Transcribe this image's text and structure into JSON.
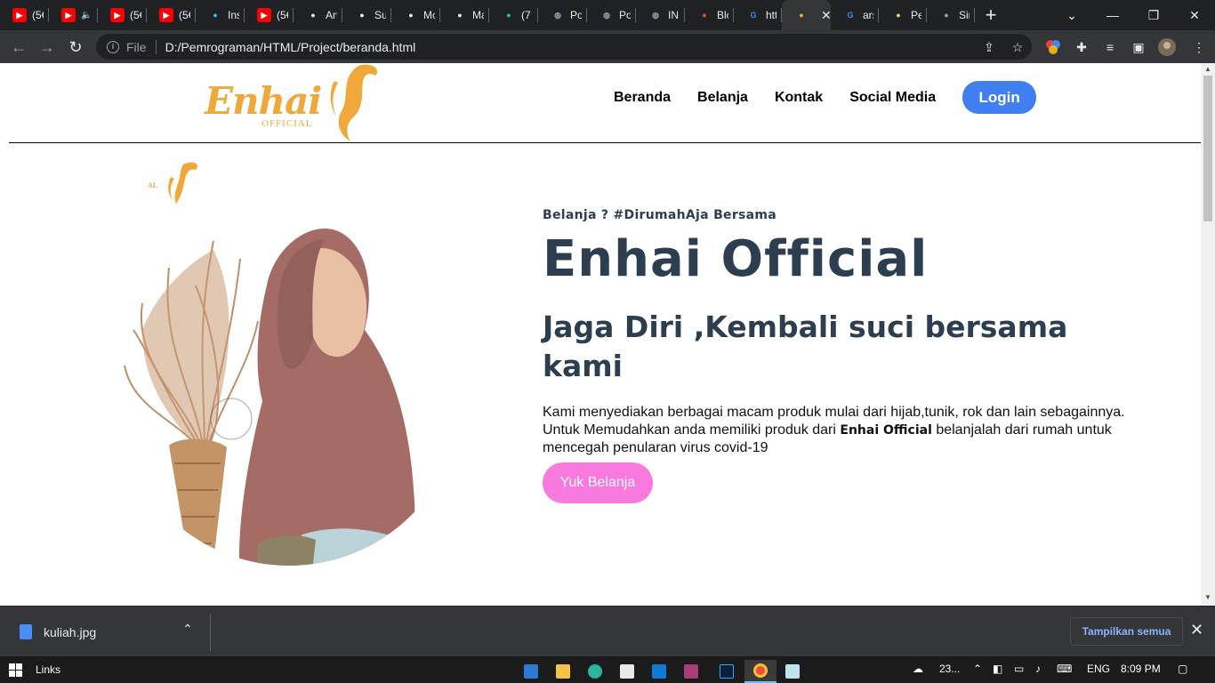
{
  "browser": {
    "tabs": [
      {
        "title": "(5€",
        "icon": "youtube-icon",
        "color": "#ff0000"
      },
      {
        "title": "",
        "icon": "youtube-icon",
        "color": "#ff0000",
        "audio": true
      },
      {
        "title": "(5€",
        "icon": "youtube-icon",
        "color": "#ff0000"
      },
      {
        "title": "(5€",
        "icon": "youtube-icon",
        "color": "#ff0000"
      },
      {
        "title": "Ins",
        "icon": "tailwind-icon",
        "color": "#38bdf8"
      },
      {
        "title": "(5€",
        "icon": "youtube-icon",
        "color": "#ff0000"
      },
      {
        "title": "Art",
        "icon": "gitbook-icon",
        "color": "#e8eaed"
      },
      {
        "title": "Sul",
        "icon": "gitbook-icon",
        "color": "#e8eaed"
      },
      {
        "title": "Mc",
        "icon": "gitbook-icon",
        "color": "#e8eaed"
      },
      {
        "title": "Ma",
        "icon": "museum-icon",
        "color": "#e8eaed"
      },
      {
        "title": "(7",
        "icon": "whatsapp-icon",
        "color": "#25d366"
      },
      {
        "title": "Po",
        "icon": "globe-icon",
        "color": "#9aa0a6"
      },
      {
        "title": "Po",
        "icon": "globe-icon",
        "color": "#9aa0a6"
      },
      {
        "title": "IN",
        "icon": "globe-icon",
        "color": "#9aa0a6"
      },
      {
        "title": "Blc",
        "icon": "blogger-icon",
        "color": "#f4511e"
      },
      {
        "title": "htt",
        "icon": "google-icon",
        "color": "#4285f4"
      },
      {
        "title": "",
        "icon": "enhai-logo-icon",
        "color": "#f0a83a",
        "active": true
      },
      {
        "title": "ars",
        "icon": "google-icon",
        "color": "#4285f4"
      },
      {
        "title": "Pe",
        "icon": "file-icon",
        "color": "#f6d36b"
      },
      {
        "title": "Sin",
        "icon": "person-icon",
        "color": "#9aa0a6"
      }
    ],
    "address": {
      "scheme": "File",
      "url": "D:/Pemrograman/HTML/Project/beranda.html"
    }
  },
  "site": {
    "logo": {
      "text": "Enhai",
      "sub": "OFFICIAL"
    },
    "nav": [
      "Beranda",
      "Belanja",
      "Kontak",
      "Social Media"
    ],
    "login": "Login",
    "hero": {
      "tagline": "Belanja ? #DirumahAja Bersama",
      "brand": "Enhai Official",
      "motto": "Jaga Diri ,Kembali suci bersama kami",
      "desc_before": "Kami menyediakan berbagai macam produk mulai dari hijab,tunik, rok dan lain sebagainnya. Untuk Memudahkan anda memiliki produk dari",
      "desc_brand": "Enhai Official",
      "desc_after": "belanjalah dari rumah untuk mencegah penularan virus covid-19",
      "cta": "Yuk Belanja",
      "image_logo_fragment": "AL"
    },
    "colors": {
      "accent": "#3f7ff0",
      "cta": "#f97ade",
      "text": "#2c3e50",
      "logo": "#f0a83a"
    }
  },
  "downloads": {
    "file": "kuliah.jpg",
    "show_all": "Tampilkan semua"
  },
  "taskbar": {
    "links": "Links",
    "weather": "23...",
    "lang": "ENG",
    "time": "8:09 PM"
  }
}
